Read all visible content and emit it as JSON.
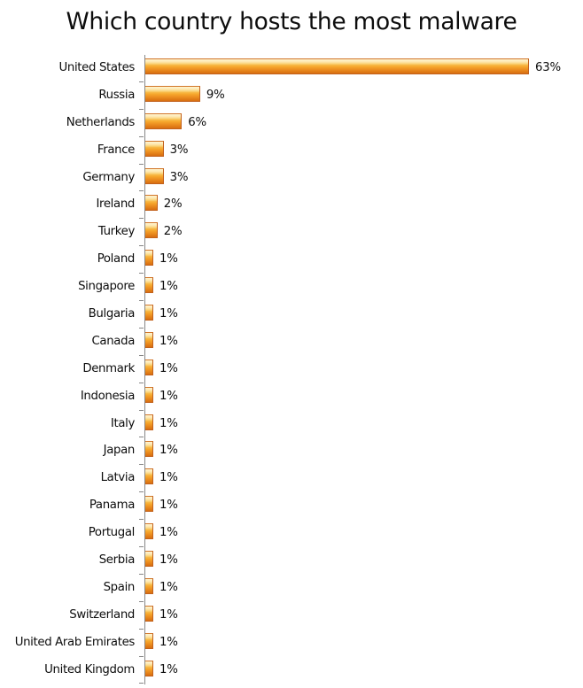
{
  "chart_data": {
    "type": "bar",
    "orientation": "horizontal",
    "title": "Which country hosts the most malware",
    "xlabel": "",
    "ylabel": "",
    "xlim": [
      0,
      63
    ],
    "grid": false,
    "legend": false,
    "axis_line": true,
    "tick_marks": true,
    "value_label_suffix": "%",
    "bar_color": "#F6A72C",
    "bar_color_light": "#FCD98B",
    "bar_color_dark": "#D86F10",
    "text_color": "#0D0D0D",
    "axis_color": "#868686",
    "categories": [
      "United States",
      "Russia",
      "Netherlands",
      "France",
      "Germany",
      "Ireland",
      "Turkey",
      "Poland",
      "Singapore",
      "Bulgaria",
      "Canada",
      "Denmark",
      "Indonesia",
      "Italy",
      "Japan",
      "Latvia",
      "Panama",
      "Portugal",
      "Serbia",
      "Spain",
      "Switzerland",
      "United Arab Emirates",
      "United Kingdom"
    ],
    "values": [
      63,
      9,
      6,
      3,
      3,
      2,
      2,
      1,
      1,
      1,
      1,
      1,
      1,
      1,
      1,
      1,
      1,
      1,
      1,
      1,
      1,
      1,
      1
    ],
    "value_labels": [
      "63%",
      "9%",
      "6%",
      "3%",
      "3%",
      "2%",
      "2%",
      "1%",
      "1%",
      "1%",
      "1%",
      "1%",
      "1%",
      "1%",
      "1%",
      "1%",
      "1%",
      "1%",
      "1%",
      "1%",
      "1%",
      "1%",
      "1%"
    ]
  }
}
